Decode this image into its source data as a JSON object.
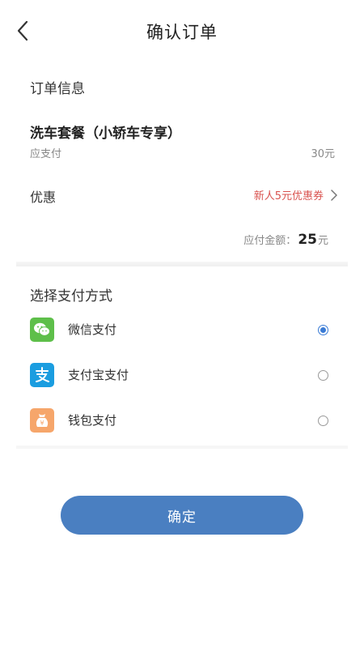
{
  "header": {
    "title": "确认订单"
  },
  "order": {
    "section_title": "订单信息",
    "product_name": "洗车套餐（小轿车专享）",
    "payable_label": "应支付",
    "payable_value": "30元",
    "discount_label": "优惠",
    "coupon_text": "新人5元优惠券",
    "total_label": "应付金额：",
    "total_amount": "25",
    "total_unit": "元"
  },
  "payment": {
    "section_title": "选择支付方式",
    "methods": [
      {
        "label": "微信支付",
        "icon": "wechat-icon",
        "color": "#5ebf4a",
        "selected": true
      },
      {
        "label": "支付宝支付",
        "icon": "alipay-icon",
        "color": "#1a9de0",
        "selected": false
      },
      {
        "label": "钱包支付",
        "icon": "wallet-icon",
        "color": "#f6a66b",
        "selected": false
      }
    ]
  },
  "actions": {
    "confirm_label": "确定"
  },
  "colors": {
    "accent": "#4a7fc1",
    "coupon": "#d9534f"
  }
}
